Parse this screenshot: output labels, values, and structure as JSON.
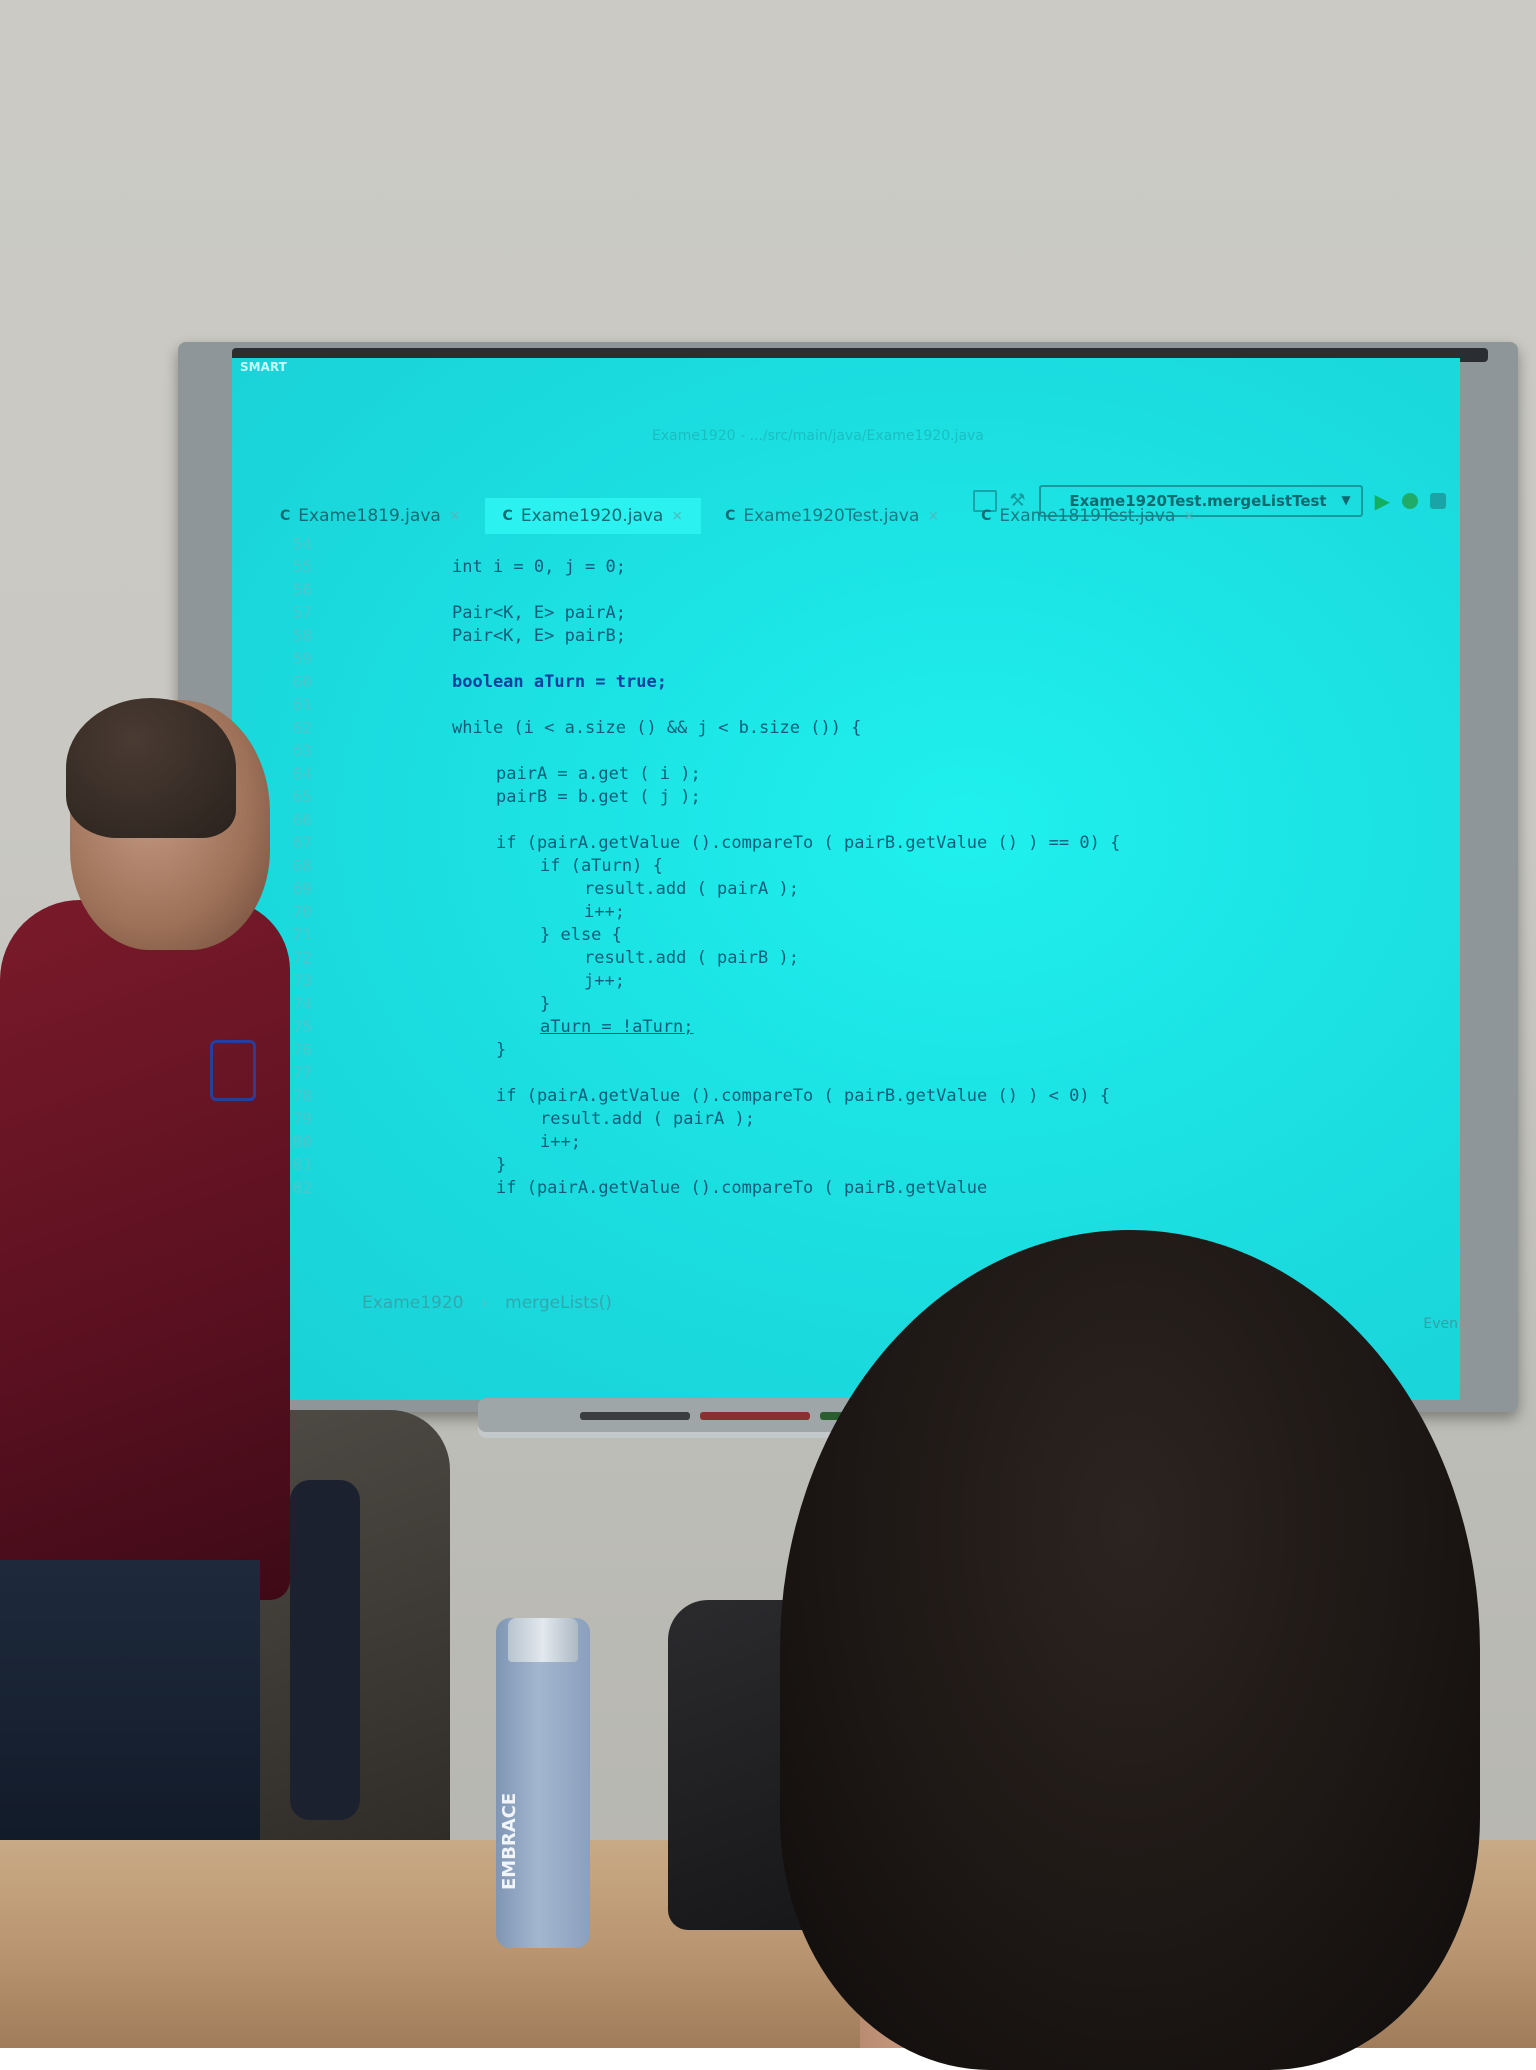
{
  "screen": {
    "brand": "SMART",
    "titlebar": "Exame1920 - .../src/main/java/Exame1920.java",
    "run_config": "Exame1920Test.mergeListTest",
    "tabs": [
      {
        "label": "Exame1819.java",
        "icon": "C"
      },
      {
        "label": "Exame1920.java",
        "icon": "C"
      },
      {
        "label": "Exame1920Test.java",
        "icon": "C"
      },
      {
        "label": "Exame1819Test.java",
        "icon": "C"
      }
    ],
    "line_numbers": [
      "54",
      "55",
      "56",
      "57",
      "58",
      "59",
      "60",
      "61",
      "62",
      "63",
      "64",
      "65",
      "66",
      "67",
      "68",
      "69",
      "70",
      "71",
      "72",
      "73",
      "74",
      "75",
      "76",
      "77",
      "78",
      "79",
      "80",
      "81",
      "82"
    ],
    "code": {
      "l55": "int i = 0, j = 0;",
      "l57": "Pair<K, E> pairA;",
      "l58": "Pair<K, E> pairB;",
      "l60": "boolean aTurn = true;",
      "l62": "while (i < a.size () && j < b.size ()) {",
      "l64": "pairA = a.get ( i );",
      "l65": "pairB = b.get ( j );",
      "l67": "if (pairA.getValue ().compareTo ( pairB.getValue () ) == 0) {",
      "l68": "if (aTurn) {",
      "l69": "result.add ( pairA );",
      "l70": "i++;",
      "l71": "} else {",
      "l72": "result.add ( pairB );",
      "l73": "j++;",
      "l74": "}",
      "l75": "aTurn = !aTurn;",
      "l76": "}",
      "l78": "if (pairA.getValue ().compareTo ( pairB.getValue () ) < 0) {",
      "l79": "result.add ( pairA );",
      "l80": "i++;",
      "l81": "}",
      "l82": "if (pairA.getValue ().compareTo ( pairB.getValue"
    },
    "breadcrumb": {
      "class": "Exame1920",
      "method": "mergeLists()"
    },
    "event_log": "Even"
  },
  "bottle_text": "EMBRACE"
}
